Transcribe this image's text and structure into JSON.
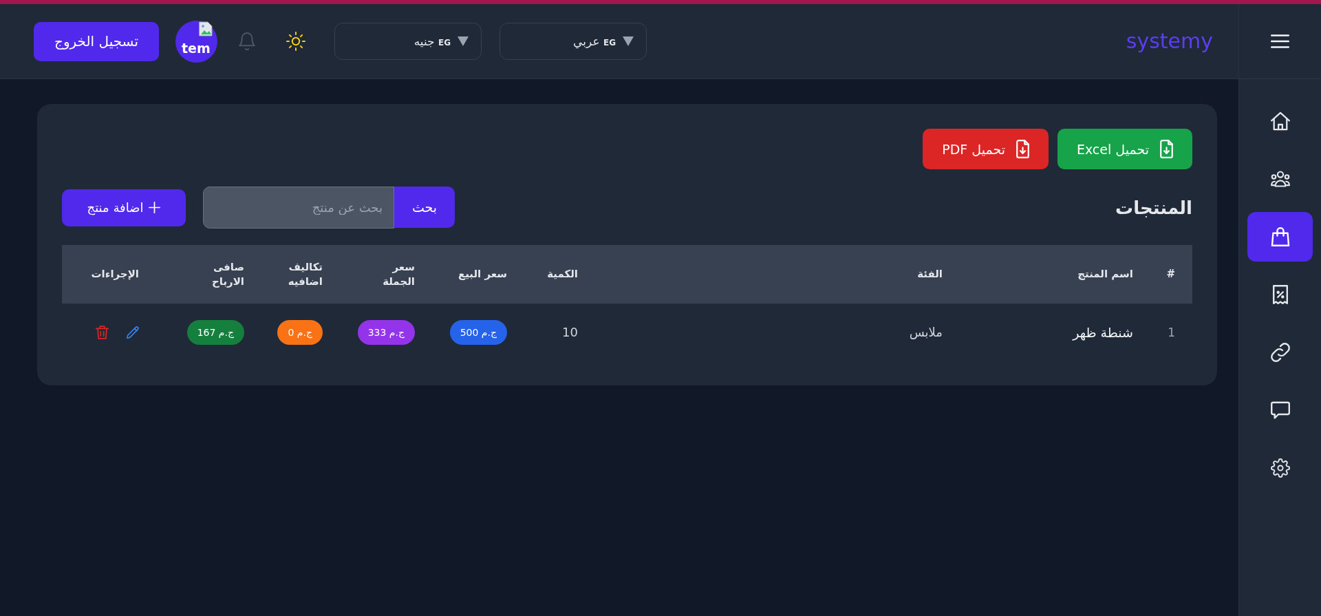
{
  "header": {
    "logo": "systemy",
    "language_select": {
      "flag": "EG",
      "label": "عربي"
    },
    "currency_select": {
      "flag": "EG",
      "label": "جنيه"
    },
    "avatar": {
      "alt_text": "tem"
    },
    "logout_button": "تسجيل الخروج"
  },
  "sidebar": {
    "items": [
      {
        "kind": "home",
        "selected": false
      },
      {
        "kind": "people",
        "selected": false
      },
      {
        "kind": "bag",
        "selected": true
      },
      {
        "kind": "receipt",
        "selected": false
      },
      {
        "kind": "link",
        "selected": false
      },
      {
        "kind": "chat",
        "selected": false
      },
      {
        "kind": "gear",
        "selected": false
      }
    ]
  },
  "products": {
    "export_buttons": [
      {
        "kind": "excel",
        "label": "تحميل Excel"
      },
      {
        "kind": "pdf",
        "label": "تحميل PDF"
      }
    ],
    "title": "المنتجات",
    "search": {
      "button": "بحث",
      "placeholder": "بحث عن منتج"
    },
    "add_button": "اضافة منتج",
    "table": {
      "columns": [
        "#",
        "اسم المنتج",
        "الفئة",
        "الكمية",
        "سعر البيع",
        "سعر الجملة",
        "تكاليف اضافيه",
        "صافى الارباح",
        "الإجراءات"
      ],
      "rows": [
        {
          "index": "1",
          "name": "شنطة ظهر",
          "category": "ملابس",
          "quantity": "10",
          "sale_price": "500 ج.م",
          "wholesale_price": "333 ج.م",
          "extra_costs": "0 ج.م",
          "net_profit": "167 ج.م"
        }
      ]
    }
  }
}
